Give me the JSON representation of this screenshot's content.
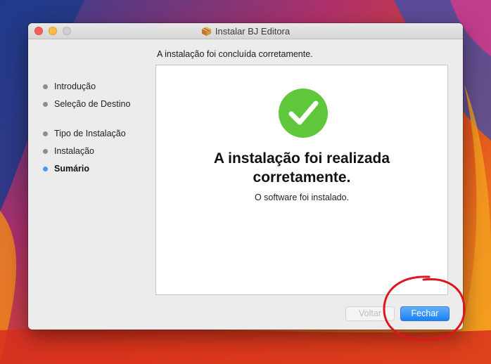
{
  "window": {
    "title": "Instalar BJ Editora"
  },
  "header": {
    "status": "A instalação foi concluída corretamente."
  },
  "sidebar": {
    "steps": [
      {
        "label": "Introdução",
        "state": "done"
      },
      {
        "label": "Seleção de Destino",
        "state": "done"
      },
      {
        "label": "Tipo de Instalação",
        "state": "done"
      },
      {
        "label": "Instalação",
        "state": "done"
      },
      {
        "label": "Sumário",
        "state": "active"
      }
    ]
  },
  "main": {
    "headline": "A instalação foi realizada corretamente.",
    "message": "O software foi instalado.",
    "icon": "checkmark-circle-icon"
  },
  "buttons": {
    "back_label": "Voltar",
    "back_enabled": false,
    "close_label": "Fechar"
  },
  "colors": {
    "success_green": "#5fc83a",
    "accent_blue": "#1a82f5",
    "active_dot": "#4a98ee",
    "annotation_red": "#e0141c"
  }
}
